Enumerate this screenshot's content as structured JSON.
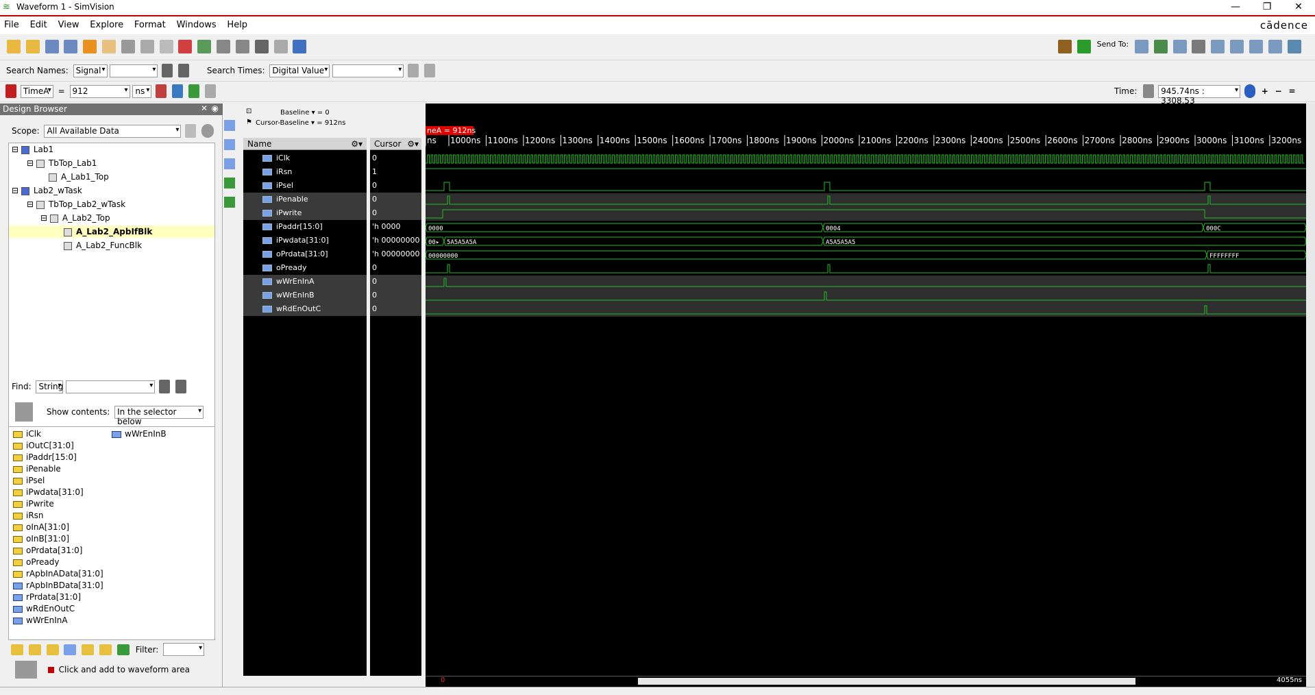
{
  "window": {
    "title": "Waveform 1 - SimVision",
    "minimize": "—",
    "restore": "❐",
    "close": "✕"
  },
  "menu": [
    "File",
    "Edit",
    "View",
    "Explore",
    "Format",
    "Windows",
    "Help"
  ],
  "brand": "cādence",
  "toolbar2": {
    "send_to": "Send To:"
  },
  "search": {
    "names_label": "Search Names:",
    "names_mode": "Signal",
    "times_label": "Search Times:",
    "times_mode": "Digital Value"
  },
  "cursor_bar": {
    "marker": "TimeA",
    "eq": "=",
    "value": "912",
    "unit": "ns",
    "time_label": "Time:",
    "time_range": "945.74ns : 3308.53"
  },
  "design_browser": {
    "title": "Design Browser",
    "scope_label": "Scope:",
    "scope_value": "All Available Data",
    "tree": [
      "Lab1",
      "TbTop_Lab1",
      "A_Lab1_Top",
      "Lab2_wTask",
      "TbTop_Lab2_wTask",
      "A_Lab2_Top",
      "A_Lab2_ApbIfBlk",
      "A_Lab2_FuncBlk"
    ],
    "find_label": "Find:",
    "find_mode": "String",
    "show_contents_label": "Show contents:",
    "show_contents_value": "In the selector below",
    "signals": [
      "iClk",
      "iOutC[31:0]",
      "iPaddr[15:0]",
      "iPenable",
      "iPsel",
      "iPwdata[31:0]",
      "iPwrite",
      "iRsn",
      "oInA[31:0]",
      "oInB[31:0]",
      "oPrdata[31:0]",
      "oPready",
      "rApbInAData[31:0]",
      "rApbInBData[31:0]",
      "rPrdata[31:0]",
      "wRdEnOutC",
      "wWrEnInA"
    ],
    "signals_col2": [
      "wWrEnInB"
    ],
    "filter_label": "Filter:",
    "click_add": "Click and add to waveform area"
  },
  "waveform": {
    "baseline": "Baseline ▾ = 0",
    "cursor_baseline": "Cursor-Baseline ▾ = 912ns",
    "name_header": "Name",
    "cursor_header": "Cursor",
    "marker_label": "neA = 912ns",
    "ticks": [
      "ns",
      "1000ns",
      "1100ns",
      "1200ns",
      "1300ns",
      "1400ns",
      "1500ns",
      "1600ns",
      "1700ns",
      "1800ns",
      "1900ns",
      "2000ns",
      "2100ns",
      "2200ns",
      "2300ns",
      "2400ns",
      "2500ns",
      "2600ns",
      "2700ns",
      "2800ns",
      "2900ns",
      "3000ns",
      "3100ns",
      "3200ns"
    ],
    "signals": [
      {
        "name": "iClk",
        "cursor": "0"
      },
      {
        "name": "iRsn",
        "cursor": "1"
      },
      {
        "name": "iPsel",
        "cursor": "0"
      },
      {
        "name": "iPenable",
        "cursor": "0"
      },
      {
        "name": "iPwrite",
        "cursor": "0"
      },
      {
        "name": "iPaddr[15:0]",
        "cursor": "'h 0000"
      },
      {
        "name": "iPwdata[31:0]",
        "cursor": "'h 00000000"
      },
      {
        "name": "oPrdata[31:0]",
        "cursor": "'h 00000000"
      },
      {
        "name": "oPready",
        "cursor": "0"
      },
      {
        "name": "wWrEnInA",
        "cursor": "0"
      },
      {
        "name": "wWrEnInB",
        "cursor": "0"
      },
      {
        "name": "wRdEnOutC",
        "cursor": "0"
      }
    ],
    "bus_labels": {
      "paddr": [
        "0000",
        "0004",
        "000C"
      ],
      "pwdata": [
        "00▸",
        "5A5A5A5A",
        "A5A5A5A5"
      ],
      "prdata": [
        "00000000",
        "FFFFFFFF"
      ]
    },
    "range_start": "0",
    "range_end": "4055ns"
  },
  "colors": {
    "wave": "#22c022",
    "accent": "#c00000",
    "marker": "#e00000"
  }
}
